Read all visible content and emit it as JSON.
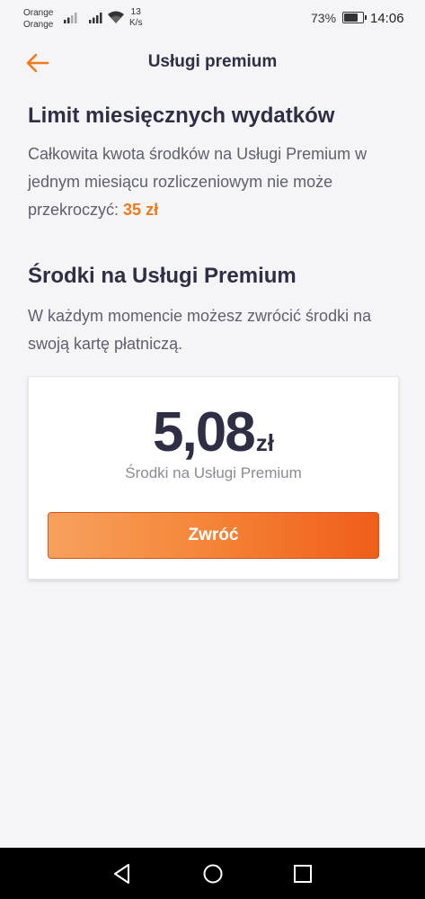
{
  "status_bar": {
    "carrier_1": "Orange",
    "carrier_2": "Orange",
    "net_speed_value": "13",
    "net_speed_unit": "K/s",
    "battery_percent": "73%",
    "battery_level": 0.73,
    "time": "14:06"
  },
  "header": {
    "title": "Usługi premium",
    "back_icon": "arrow-left-icon"
  },
  "spending_limit": {
    "heading": "Limit miesięcznych wydatków",
    "description": "Całkowita kwota środków na Usługi Premium w jednym miesiącu rozliczeniowym nie może przekroczyć:",
    "amount": "35 zł"
  },
  "premium_funds": {
    "heading": "Środki na Usługi Premium",
    "description": "W każdym momencie możesz zwrócić środki na swoją kartę płatniczą."
  },
  "balance_card": {
    "value": "5,08",
    "currency": "zł",
    "label": "Środki na Usługi Premium",
    "refund_button": "Zwróć"
  },
  "nav_bar": {
    "back_icon": "triangle-back-icon",
    "home_icon": "circle-home-icon",
    "recents_icon": "square-recents-icon"
  },
  "colors": {
    "accent": "#f07a1a",
    "text_dark": "#2e2f45",
    "background": "#f5f5f8"
  }
}
